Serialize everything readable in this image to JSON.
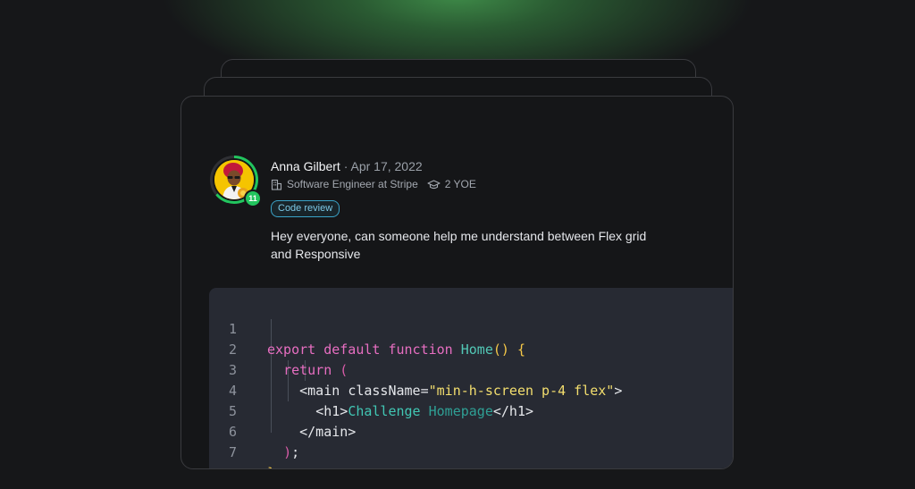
{
  "post": {
    "author": "Anna Gilbert",
    "date": "· Apr 17, 2022",
    "role": "Software Engineer at Stripe",
    "experience": "2 YOE",
    "level": "11",
    "tag": "Code review",
    "body": "Hey everyone, can someone help me understand between Flex grid and Responsive"
  },
  "code": {
    "line_numbers": [
      "1",
      "2",
      "3",
      "4",
      "5",
      "6",
      "7"
    ],
    "tokens": {
      "l1_export": "export",
      "l1_default": "default",
      "l1_function": "function",
      "l1_name": "Home",
      "l1_paren": "()",
      "l1_brace": "{",
      "l2_return": "return",
      "l2_paren": "(",
      "l3_open": "<main",
      "l3_attr": "className=",
      "l3_value": "\"min-h-screen p-4 flex\"",
      "l3_close": ">",
      "l4_open": "<h1>",
      "l4_word1": "Challenge",
      "l4_word2": "Homepage",
      "l4_close": "</h1>",
      "l5_close": "</main>",
      "l6_paren": ")",
      "l6_semi": ";",
      "l7_brace": "}"
    }
  },
  "colors": {
    "accent_green": "#22c55e",
    "tag_blue": "#3aa3c8",
    "keyword_pink": "#e76ec1",
    "string_yellow": "#f3de6e",
    "function_teal": "#52c8b6"
  }
}
